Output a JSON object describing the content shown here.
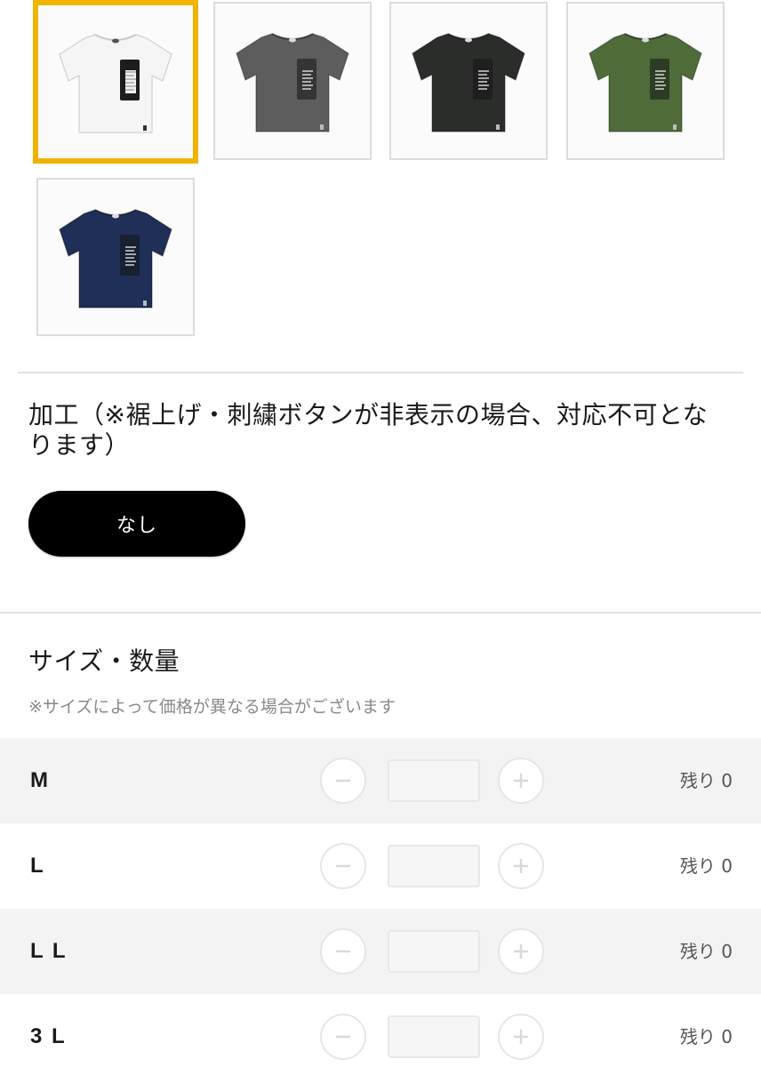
{
  "colors": {
    "selected_border": "#f0b400",
    "pill_bg": "#000000",
    "row_shade": "#f3f3f3"
  },
  "swatches": [
    {
      "name": "white",
      "color": "#f5f5f5",
      "selected": true
    },
    {
      "name": "gray",
      "color": "#5d5d5d",
      "selected": false
    },
    {
      "name": "black",
      "color": "#2b2d2b",
      "selected": false
    },
    {
      "name": "olive",
      "color": "#4f6b3a",
      "selected": false
    },
    {
      "name": "navy",
      "color": "#1f2f57",
      "selected": false
    }
  ],
  "processing": {
    "title": "加工（※裾上げ・刺繍ボタンが非表示の場合、対応不可となります）",
    "option_label": "なし"
  },
  "size_section": {
    "title": "サイズ・数量",
    "note": "※サイズによって価格が異なる場合がございます"
  },
  "sizes": [
    {
      "label": "M",
      "remaining": "残り 0"
    },
    {
      "label": "L",
      "remaining": "残り 0"
    },
    {
      "label": "L L",
      "remaining": "残り 0"
    },
    {
      "label": "3 L",
      "remaining": "残り 0"
    }
  ]
}
